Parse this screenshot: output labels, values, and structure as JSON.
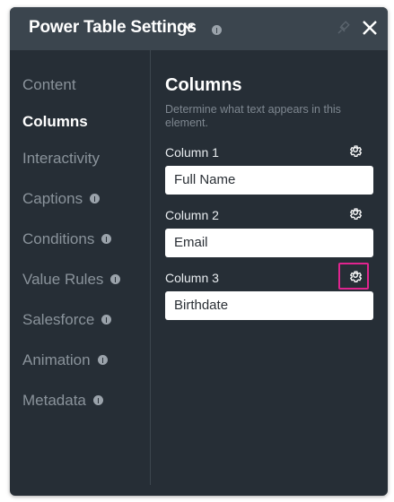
{
  "header": {
    "title": "Power Table Settings",
    "icons": [
      "chevron-down-icon",
      "info-icon",
      "pin-icon",
      "close-icon"
    ]
  },
  "sidebar": {
    "items": [
      {
        "label": "Content",
        "active": false,
        "info": false
      },
      {
        "label": "Columns",
        "active": true,
        "info": false
      },
      {
        "label": "Interactivity",
        "active": false,
        "info": false
      },
      {
        "label": "Captions",
        "active": false,
        "info": true
      },
      {
        "label": "Conditions",
        "active": false,
        "info": true
      },
      {
        "label": "Value Rules",
        "active": false,
        "info": true
      },
      {
        "label": "Salesforce",
        "active": false,
        "info": true
      },
      {
        "label": "Animation",
        "active": false,
        "info": true
      },
      {
        "label": "Metadata",
        "active": false,
        "info": true
      }
    ]
  },
  "main": {
    "title": "Columns",
    "description": "Determine what text appears in this element.",
    "columns": [
      {
        "label": "Column 1",
        "value": "Full Name"
      },
      {
        "label": "Column 2",
        "value": "Email"
      },
      {
        "label": "Column 3",
        "value": "Birthdate",
        "highlighted": true
      }
    ]
  },
  "colors": {
    "panel_bg": "#262e36",
    "header_bg": "#3b454e",
    "highlight": "#e0248f"
  }
}
